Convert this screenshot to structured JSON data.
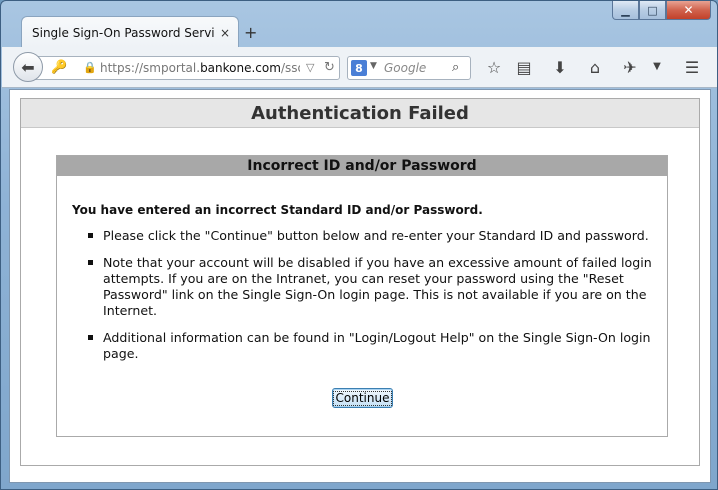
{
  "browser": {
    "tab_title": "Single Sign-On Password Servi...",
    "tab_close": "×",
    "new_tab": "+",
    "url_prefix": "https://smportal.",
    "url_domain": "bankone.com",
    "url_suffix": "/sso/A",
    "search_engine_letter": "8",
    "search_placeholder": "Google",
    "window_controls": {
      "minimize": "▁",
      "maximize": "□",
      "close": "✕"
    },
    "toolbar_icons": [
      "back-icon",
      "key-icon",
      "lock-icon",
      "dropdown-icon",
      "reload-icon",
      "search-icon",
      "star-icon",
      "reading-list-icon",
      "download-icon",
      "home-icon",
      "addon-icon",
      "menu-dropdown-icon",
      "hamburger-menu-icon"
    ]
  },
  "page": {
    "title": "Authentication Failed",
    "box_title": "Incorrect ID and/or Password",
    "main_message": "You have entered an incorrect Standard ID and/or Password.",
    "bullets": [
      "Please click the \"Continue\" button below and re-enter your Standard ID and password.",
      "Note that your account will be disabled if you have an excessive amount of failed login attempts. If you are on the Intranet, you can reset your password using the \"Reset Password\" link on the Single Sign-On login page. This is not available if you are on the Internet.",
      "Additional information can be found in \"Login/Logout Help\" on the Single Sign-On login page."
    ],
    "continue_label": "Continue"
  },
  "colors": {
    "window_frame": "#8fb3d6",
    "header_bg": "#e6e6e6",
    "box_header_bg": "#a8a8a8",
    "button_border": "#3c7fb1"
  }
}
